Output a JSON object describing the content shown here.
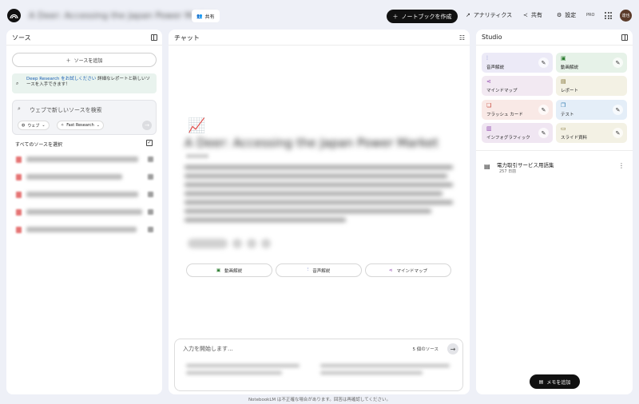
{
  "topbar": {
    "notebook_title": "A Deer: Accessing the Japan Power Market",
    "share_chip": "共有",
    "create_notebook": "ノートブックを作成",
    "analytics": "アナリティクス",
    "share": "共有",
    "settings": "設定",
    "pro": "PRO",
    "avatar": "達也"
  },
  "sources": {
    "title": "ソース",
    "add_source": "ソースを追加",
    "deep_research_link": "Deep Research をお試しください",
    "deep_research_text": " 詳細なレポートと新しいソースを入手できます！",
    "search_placeholder": "ウェブで新しいソースを検索",
    "chip_web": "ウェブ",
    "chip_fast": "Fast Research",
    "select_all": "すべてのソースを選択"
  },
  "chat": {
    "title": "チャット",
    "doc_title": "A Deer: Accessing the Japan Power Market",
    "btn_video": "動画解説",
    "btn_audio": "音声解説",
    "btn_mindmap": "マインドマップ",
    "input_placeholder": "入力を開始します...",
    "source_count": "5 個のソース"
  },
  "footer": "NotebookLM は不正確な場合があります。回答は再確認してください。",
  "studio": {
    "title": "Studio",
    "tiles": [
      {
        "label": "音声解説",
        "icon": "audio-icon",
        "color": "#eceaf7"
      },
      {
        "label": "動画解説",
        "icon": "video-icon",
        "color": "#e6f2e8"
      },
      {
        "label": "マインドマップ",
        "icon": "mindmap-icon",
        "color": "#f2e9f2"
      },
      {
        "label": "レポート",
        "icon": "report-icon",
        "color": "#f3f1e4"
      },
      {
        "label": "フラッシュ カード",
        "icon": "flashcard-icon",
        "color": "#f9e9e6"
      },
      {
        "label": "テスト",
        "icon": "quiz-icon",
        "color": "#e4eef8"
      },
      {
        "label": "インフォグラフィック",
        "icon": "infographic-icon",
        "color": "#f0e6f2"
      },
      {
        "label": "スライド資料",
        "icon": "slides-icon",
        "color": "#f3f1e4"
      }
    ],
    "note_title": "電力取引サービス用語集",
    "note_date": "257 日前",
    "add_memo": "メモを追加"
  }
}
